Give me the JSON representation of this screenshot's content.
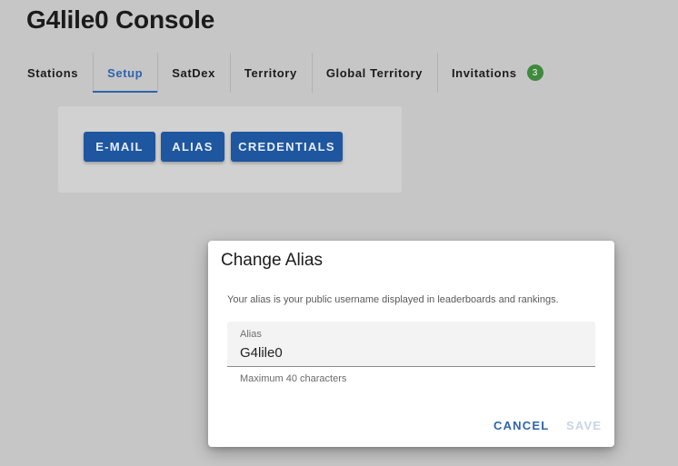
{
  "header": {
    "title": "G4lile0 Console"
  },
  "tabs": [
    {
      "label": "Stations"
    },
    {
      "label": "Setup"
    },
    {
      "label": "SatDex"
    },
    {
      "label": "Territory"
    },
    {
      "label": "Global Territory"
    },
    {
      "label": "Invitations",
      "badge": "3"
    }
  ],
  "setup": {
    "buttons": {
      "email": "E-MAIL",
      "alias": "ALIAS",
      "credentials": "CREDENTIALS"
    }
  },
  "dialog": {
    "title": "Change Alias",
    "description": "Your alias is your public username displayed in leaderboards and rankings.",
    "field": {
      "label": "Alias",
      "value": "G4lile0"
    },
    "hint": "Maximum 40 characters",
    "cancel_label": "CANCEL",
    "save_label": "SAVE"
  },
  "colors": {
    "accent": "#2e64ad",
    "button": "#1e56a0",
    "badge": "#3f8a3c",
    "save_disabled": "#c7d5e6"
  }
}
